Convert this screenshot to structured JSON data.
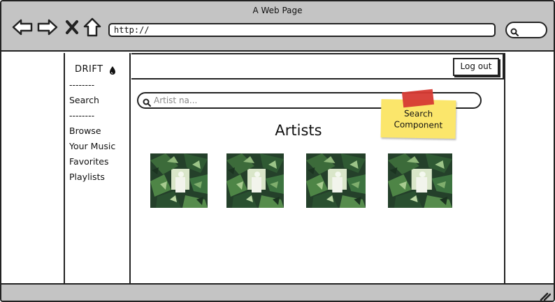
{
  "window": {
    "title": "A Web Page"
  },
  "toolbar": {
    "back_icon": "back-arrow-icon",
    "forward_icon": "forward-arrow-icon",
    "close_icon": "close-x-icon",
    "home_icon": "home-icon",
    "address_value": "http://",
    "search_icon": "search-icon"
  },
  "sidebar": {
    "brand": "DRIFT",
    "brand_icon": "drop-icon",
    "divider": "--------",
    "items": [
      {
        "label": "Search"
      },
      {
        "label": "Browse"
      },
      {
        "label": "Your Music"
      },
      {
        "label": "Favorites"
      },
      {
        "label": "Playlists"
      }
    ]
  },
  "header": {
    "logout_label": "Log out"
  },
  "search": {
    "placeholder": "Artist na..."
  },
  "main": {
    "heading": "Artists",
    "artists": [
      {
        "image": "jungle-foliage-image"
      },
      {
        "image": "jungle-foliage-image"
      },
      {
        "image": "jungle-foliage-image"
      },
      {
        "image": "jungle-foliage-image"
      }
    ]
  },
  "annotation": {
    "note_line1": "Search",
    "note_line2": "Component",
    "note_color": "#fbe66b",
    "tape_color": "#d63a33"
  },
  "statusbar": {
    "grip_icon": "resize-grip-icon"
  }
}
